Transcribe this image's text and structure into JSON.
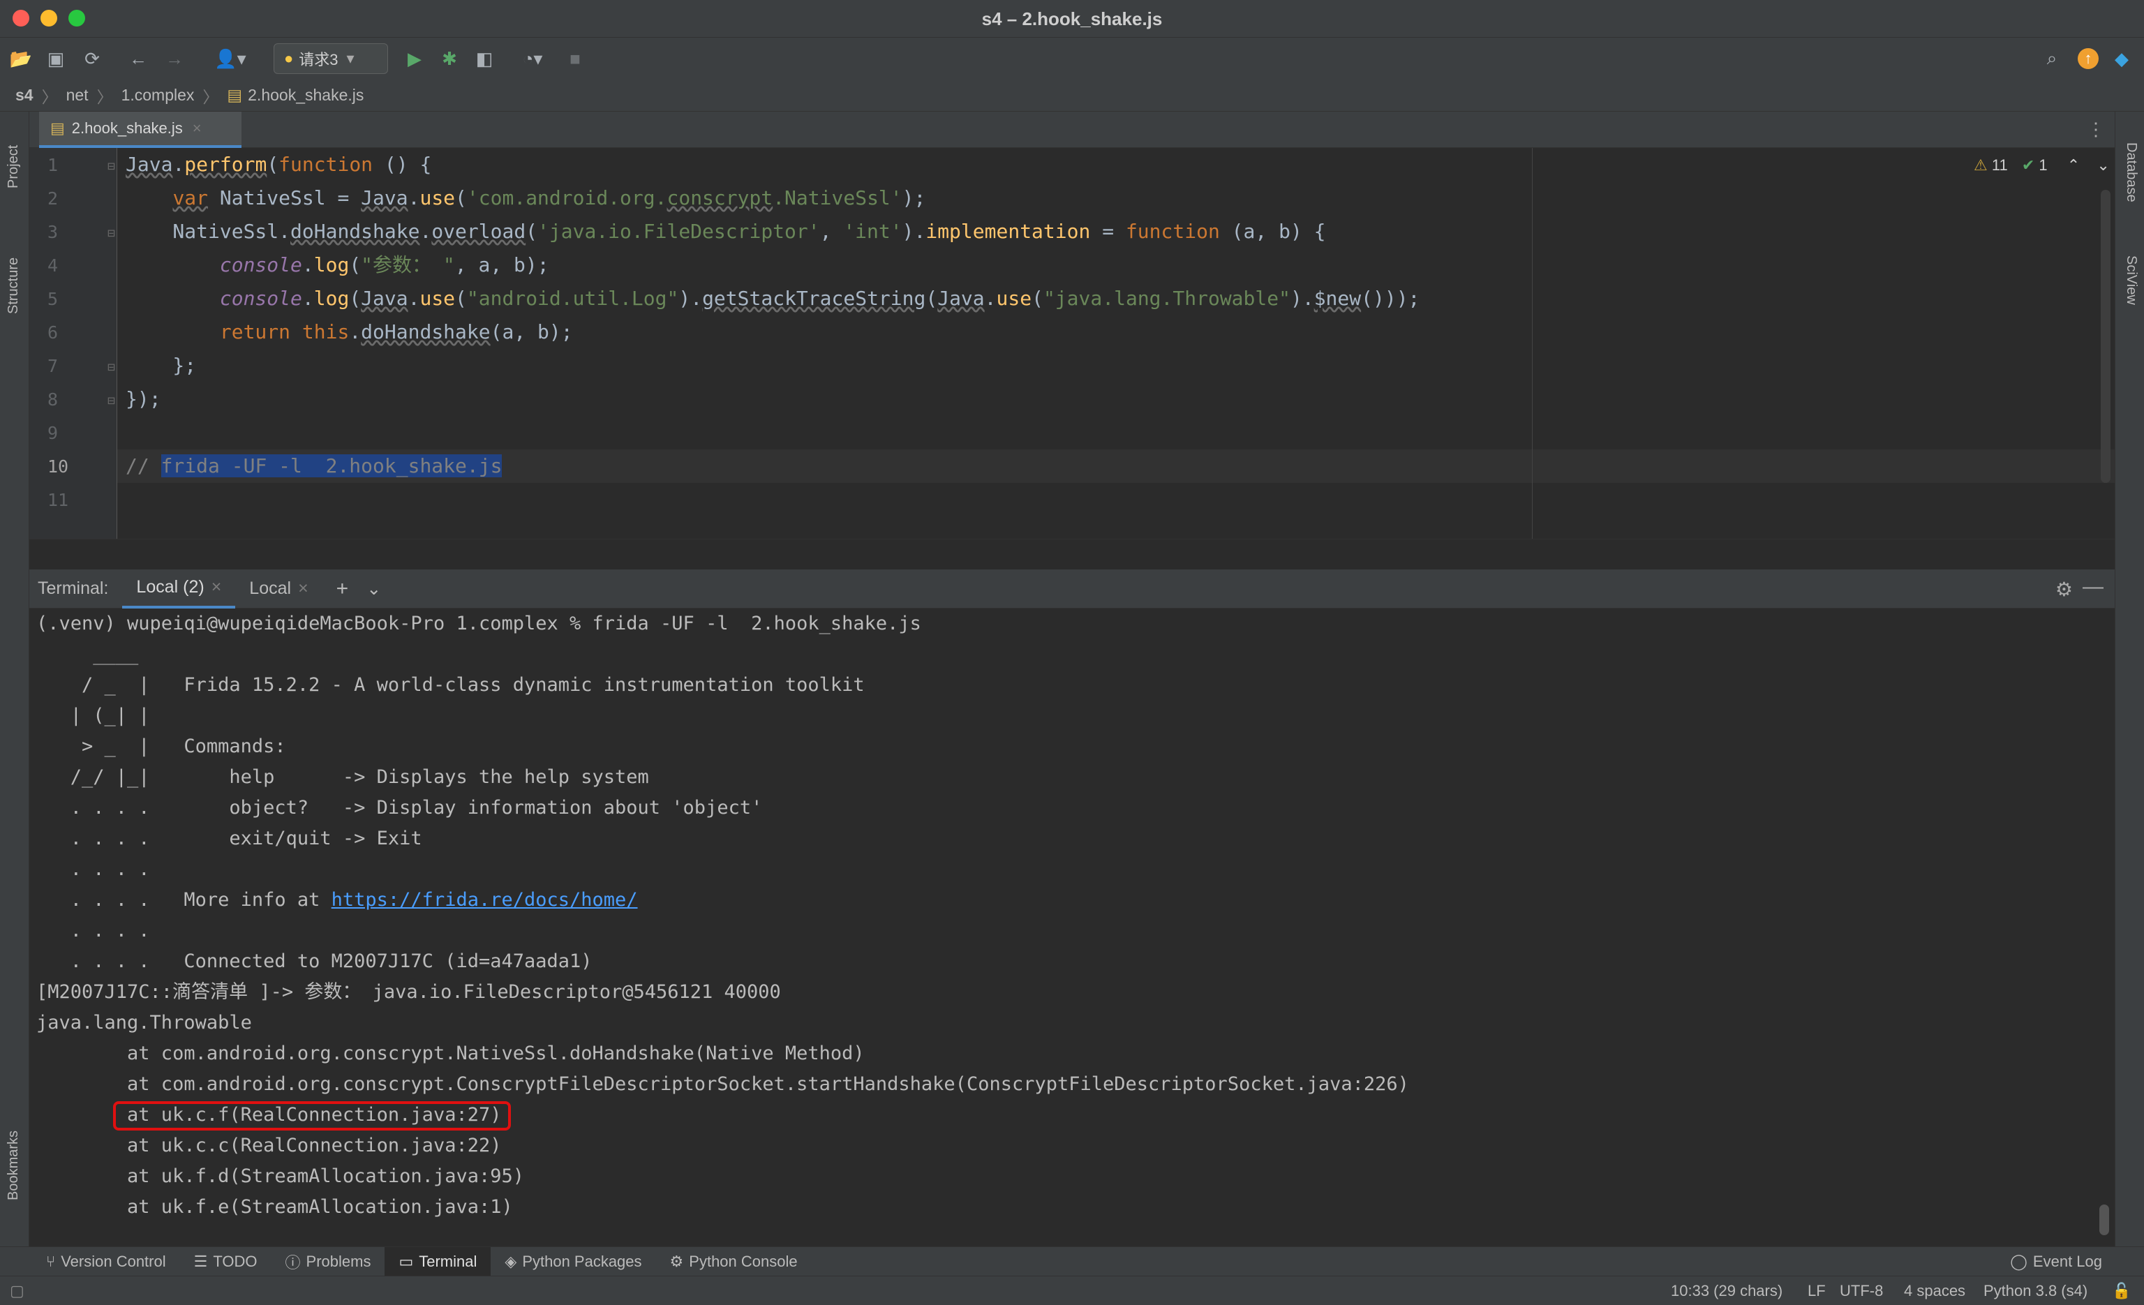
{
  "window": {
    "title": "s4 – 2.hook_shake.js"
  },
  "toolbar": {
    "run_config": "请求3"
  },
  "breadcrumb": [
    "s4",
    "net",
    "1.complex",
    "2.hook_shake.js"
  ],
  "side_tools": {
    "project": "Project",
    "structure": "Structure",
    "bookmarks": "Bookmarks",
    "database": "Database",
    "sciview": "SciView"
  },
  "editor": {
    "tab": "2.hook_shake.js",
    "inspections": {
      "warnings": "11",
      "checks": "1"
    },
    "line_numbers": [
      "1",
      "2",
      "3",
      "4",
      "5",
      "6",
      "7",
      "8",
      "9",
      "10",
      "11"
    ]
  },
  "terminal": {
    "label": "Terminal:",
    "tabs": [
      "Local (2)",
      "Local"
    ],
    "prompt": "(.venv) wupeiqi@wupeiqideMacBook-Pro 1.complex % frida -UF -l  2.hook_shake.js",
    "banner": [
      "     ____",
      "    / _  |   Frida 15.2.2 - A world-class dynamic instrumentation toolkit",
      "   | (_| |",
      "    > _  |   Commands:",
      "   /_/ |_|       help      -> Displays the help system",
      "   . . . .       object?   -> Display information about 'object'",
      "   . . . .       exit/quit -> Exit",
      "   . . . .",
      "   . . . .   More info at ",
      "   . . . .",
      "   . . . .   Connected to M2007J17C (id=a47aada1)"
    ],
    "link": "https://frida.re/docs/home/",
    "output": [
      "[M2007J17C::滴答清单 ]-> 参数： java.io.FileDescriptor@5456121 40000",
      "java.lang.Throwable",
      "        at com.android.org.conscrypt.NativeSsl.doHandshake(Native Method)",
      "        at com.android.org.conscrypt.ConscryptFileDescriptorSocket.startHandshake(ConscryptFileDescriptorSocket.java:226)",
      "        at uk.c.f(RealConnection.java:27)",
      "        at uk.c.c(RealConnection.java:22)",
      "        at uk.f.d(StreamAllocation.java:95)",
      "        at uk.f.e(StreamAllocation.java:1)"
    ]
  },
  "tool_windows": [
    "Version Control",
    "TODO",
    "Problems",
    "Terminal",
    "Python Packages",
    "Python Console"
  ],
  "event_log": "Event Log",
  "status": {
    "position": "10:33 (29 chars)",
    "line_sep": "LF",
    "encoding": "UTF-8",
    "indent": "4 spaces",
    "interpreter": "Python 3.8 (s4)"
  },
  "colors": {
    "accent": "#4a88c7",
    "highlight_box": "#e01010",
    "keyword": "#cc7832",
    "string": "#6a8759",
    "function": "#ffc66d"
  }
}
